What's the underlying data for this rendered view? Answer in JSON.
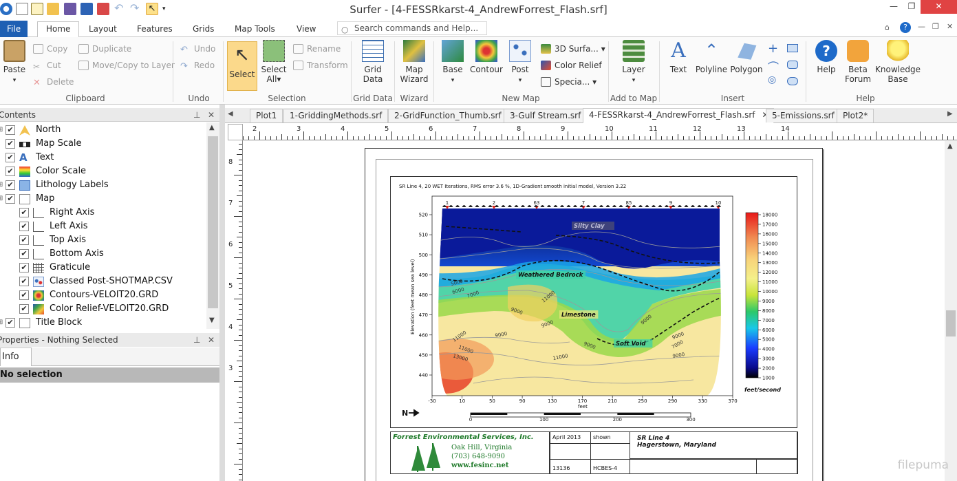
{
  "window": {
    "title": "Surfer - [4-FESSRkarst-4_AndrewForrest_Flash.srf]"
  },
  "ribbon_tabs": [
    "File",
    "Home",
    "Layout",
    "Features",
    "Grids",
    "Map Tools",
    "View"
  ],
  "search": {
    "placeholder": "Search commands and Help..."
  },
  "ribbon": {
    "clipboard": {
      "paste": "Paste",
      "copy": "Copy",
      "cut": "Cut",
      "delete": "Delete",
      "duplicate": "Duplicate",
      "move_copy": "Move/Copy to Layer",
      "label": "Clipboard"
    },
    "undo": {
      "undo": "Undo",
      "redo": "Redo",
      "label": "Undo"
    },
    "selection": {
      "select": "Select",
      "select_all_1": "Select",
      "select_all_2": "All",
      "rename": "Rename",
      "transform": "Transform",
      "label": "Selection"
    },
    "grid_data": {
      "btn_1": "Grid",
      "btn_2": "Data",
      "label": "Grid Data"
    },
    "wizard": {
      "btn_1": "Map",
      "btn_2": "Wizard",
      "label": "Wizard"
    },
    "new_map": {
      "base": "Base",
      "contour": "Contour",
      "post": "Post",
      "surface": "3D Surfa...",
      "color_relief": "Color Relief",
      "special": "Specia...",
      "label": "New Map"
    },
    "add_to_map": {
      "layer": "Layer",
      "label": "Add to Map"
    },
    "insert": {
      "text": "Text",
      "polyline": "Polyline",
      "polygon": "Polygon",
      "label": "Insert"
    },
    "help": {
      "help": "Help",
      "beta_1": "Beta",
      "beta_2": "Forum",
      "kb_1": "Knowledge",
      "kb_2": "Base",
      "label": "Help"
    }
  },
  "contents_panel": {
    "title": "Contents",
    "items": [
      {
        "label": "North",
        "icon": "north-arrow-icon"
      },
      {
        "label": "Map Scale",
        "icon": "scale-bar-icon"
      },
      {
        "label": "Text",
        "icon": "text-a-icon"
      },
      {
        "label": "Color Scale",
        "icon": "color-scale-icon"
      },
      {
        "label": "Lithology Labels",
        "icon": "label-post-icon"
      },
      {
        "label": "Map",
        "icon": "map-frame-icon"
      },
      {
        "label": "Right Axis",
        "icon": "axis-icon"
      },
      {
        "label": "Left Axis",
        "icon": "axis-icon"
      },
      {
        "label": "Top Axis",
        "icon": "axis-icon"
      },
      {
        "label": "Bottom Axis",
        "icon": "axis-icon"
      },
      {
        "label": "Graticule",
        "icon": "graticule-icon"
      },
      {
        "label": "Classed Post-SHOTMAP.CSV",
        "icon": "classed-post-icon"
      },
      {
        "label": "Contours-VELOIT20.GRD",
        "icon": "contour-icon"
      },
      {
        "label": "Color Relief-VELOIT20.GRD",
        "icon": "color-relief-icon"
      },
      {
        "label": "Title Block",
        "icon": "title-block-icon"
      }
    ]
  },
  "properties_panel": {
    "title": "Properties - Nothing Selected",
    "tab": "Info",
    "status": "No selection"
  },
  "doc_tabs": [
    "Plot1",
    "1-GriddingMethods.srf",
    "2-GridFunction_Thumb.srf",
    "3-Gulf Stream.srf",
    "4-FESSRkarst-4_AndrewForrest_Flash.srf",
    "5-Emissions.srf",
    "Plot2*"
  ],
  "hruler_labels": [
    "2",
    "3",
    "4",
    "5",
    "6",
    "7",
    "8",
    "9",
    "10",
    "11",
    "12",
    "13",
    "14"
  ],
  "vruler_labels": [
    "8",
    "7",
    "6",
    "5",
    "4",
    "3"
  ],
  "map": {
    "header": "SR Line 4, 20 WET Iterations, RMS error 3.6 %, 1D-Gradient smooth initial model, Version 3.22",
    "ylabel": "Elevation (feet mean sea level)",
    "xlabel": "feet",
    "y_ticks": [
      "520",
      "510",
      "500",
      "490",
      "480",
      "470",
      "460",
      "450",
      "440"
    ],
    "x_ticks": [
      "-30",
      "10",
      "50",
      "90",
      "130",
      "170",
      "210",
      "250",
      "290",
      "330",
      "370"
    ],
    "shot_labels": [
      "1",
      "2",
      "63",
      "7",
      "85",
      "9",
      "10"
    ],
    "zones": [
      "Silty Clay",
      "Weathered Bedrock",
      "Limestone",
      "Soft Void"
    ],
    "contour_labels": [
      "5000",
      "6000",
      "7000",
      "9000",
      "11000",
      "9000",
      "9000",
      "11000",
      "9000",
      "9000",
      "11000",
      "11000",
      "9000",
      "7000",
      "13000",
      "9000"
    ],
    "colorbar_ticks": [
      "18000",
      "17000",
      "16000",
      "15000",
      "14000",
      "13000",
      "12000",
      "11000",
      "10000",
      "9000",
      "8000",
      "7000",
      "6000",
      "5000",
      "4000",
      "3000",
      "2000",
      "1000"
    ],
    "colorbar_unit": "feet/second",
    "north_label": "N",
    "scale_ticks": [
      "0",
      "100",
      "200",
      "300"
    ]
  },
  "title_block": {
    "company": "Forrest Environmental Services, Inc.",
    "city": "Oak Hill, Virginia",
    "phone": "(703) 648-9090",
    "web": "www.fesinc.net",
    "date": "April 2013",
    "scale": "shown",
    "job": "13136",
    "drawing": "HCBES-4",
    "line": "SR Line 4",
    "location": "Hagerstown, Maryland"
  },
  "watermark": "filepuma"
}
